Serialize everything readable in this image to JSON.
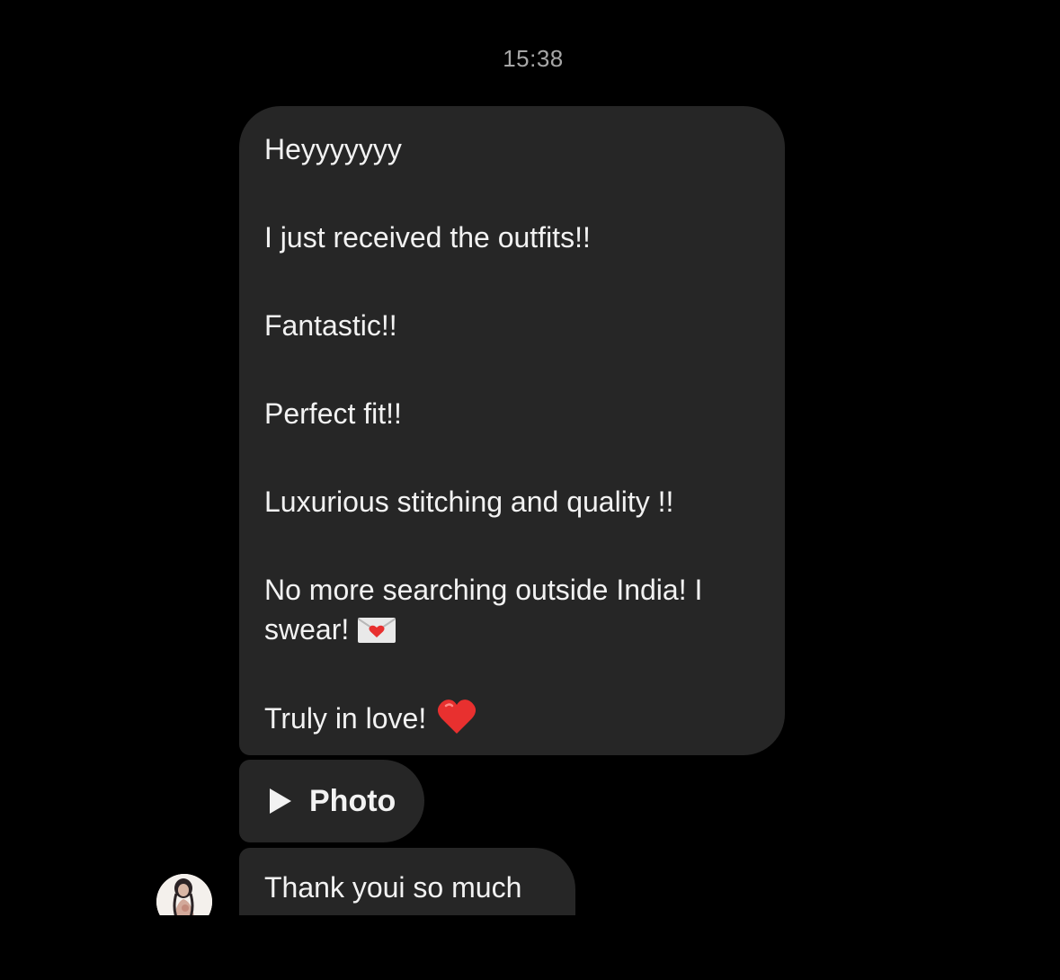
{
  "chat": {
    "timestamp": "15:38",
    "message_lines": {
      "l1": "Heyyyyyyy",
      "l2": "I just received the outfits!!",
      "l3": "Fantastic!!",
      "l4": "Perfect fit!!",
      "l5": "Luxurious stitching and quality !!",
      "l6a": "No more searching outside India! I",
      "l6b": "swear!",
      "l7": "Truly in love!"
    },
    "photo_label": "Photo",
    "last_message": "Thank youi so much",
    "icons": {
      "envelope": "love-letter-icon",
      "heart": "red-heart-icon",
      "play": "play-icon",
      "avatar": "avatar"
    },
    "colors": {
      "background": "#000000",
      "bubble": "#262626",
      "text": "#f2f2f2",
      "timestamp": "#a6a6a6",
      "heart": "#e8302f"
    }
  }
}
